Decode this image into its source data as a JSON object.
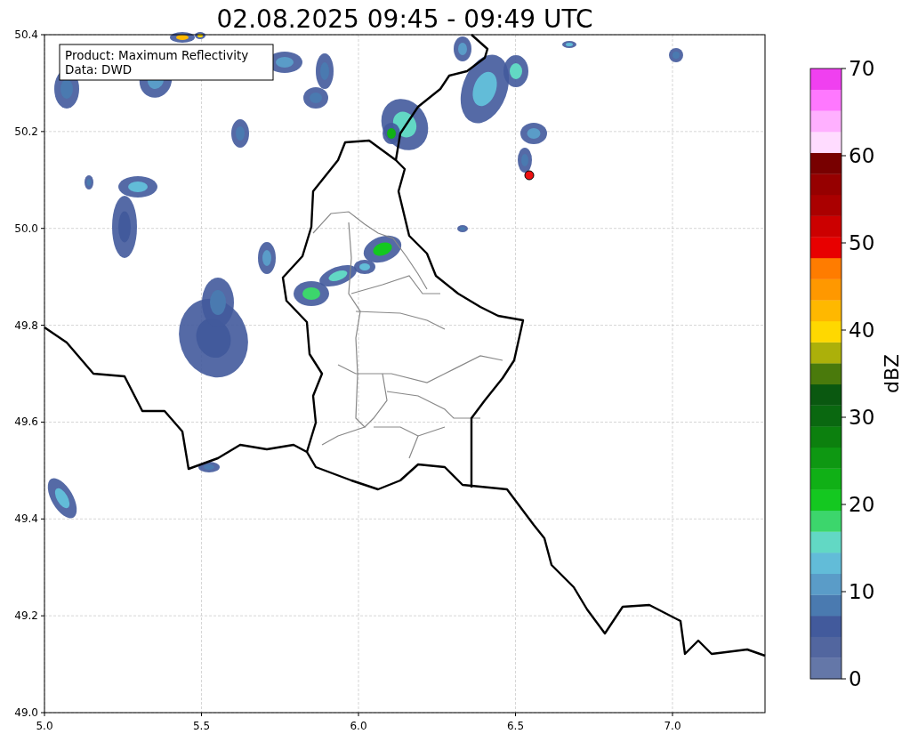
{
  "title": "02.08.2025 09:45 - 09:49 UTC",
  "annotation": [
    "Product: Maximum Reflectivity",
    "Data: DWD"
  ],
  "map": {
    "xticks": [
      "5.0",
      "5.5",
      "6.0",
      "6.5",
      "7.0"
    ],
    "yticks": [
      "50.4",
      "50.2",
      "50.0",
      "49.8",
      "49.6",
      "49.4",
      "49.2",
      "49.0"
    ],
    "marker": {
      "color": "#ee1111"
    }
  },
  "colorbar": {
    "label": "dBZ",
    "ticks": [
      "70",
      "60",
      "50",
      "40",
      "30",
      "20",
      "10",
      "0"
    ],
    "segments": [
      {
        "color": "#6477a8"
      },
      {
        "color": "#52669f"
      },
      {
        "color": "#425a9c"
      },
      {
        "color": "#4a7ab0"
      },
      {
        "color": "#5a9cc8"
      },
      {
        "color": "#62bcd8"
      },
      {
        "color": "#62d8c4"
      },
      {
        "color": "#3cd66c"
      },
      {
        "color": "#14c820"
      },
      {
        "color": "#10b016"
      },
      {
        "color": "#0e9812"
      },
      {
        "color": "#0c800e"
      },
      {
        "color": "#0a6810"
      },
      {
        "color": "#0a5810"
      },
      {
        "color": "#4a7a0c"
      },
      {
        "color": "#acb00a"
      },
      {
        "color": "#ffd800"
      },
      {
        "color": "#ffb800"
      },
      {
        "color": "#ff9800"
      },
      {
        "color": "#ff7c00"
      },
      {
        "color": "#e80000"
      },
      {
        "color": "#cc0000"
      },
      {
        "color": "#aa0000"
      },
      {
        "color": "#960000"
      },
      {
        "color": "#780000"
      },
      {
        "color": "#ffdcff"
      },
      {
        "color": "#ffb0ff"
      },
      {
        "color": "#ff78ff"
      },
      {
        "color": "#f040f0"
      }
    ]
  }
}
